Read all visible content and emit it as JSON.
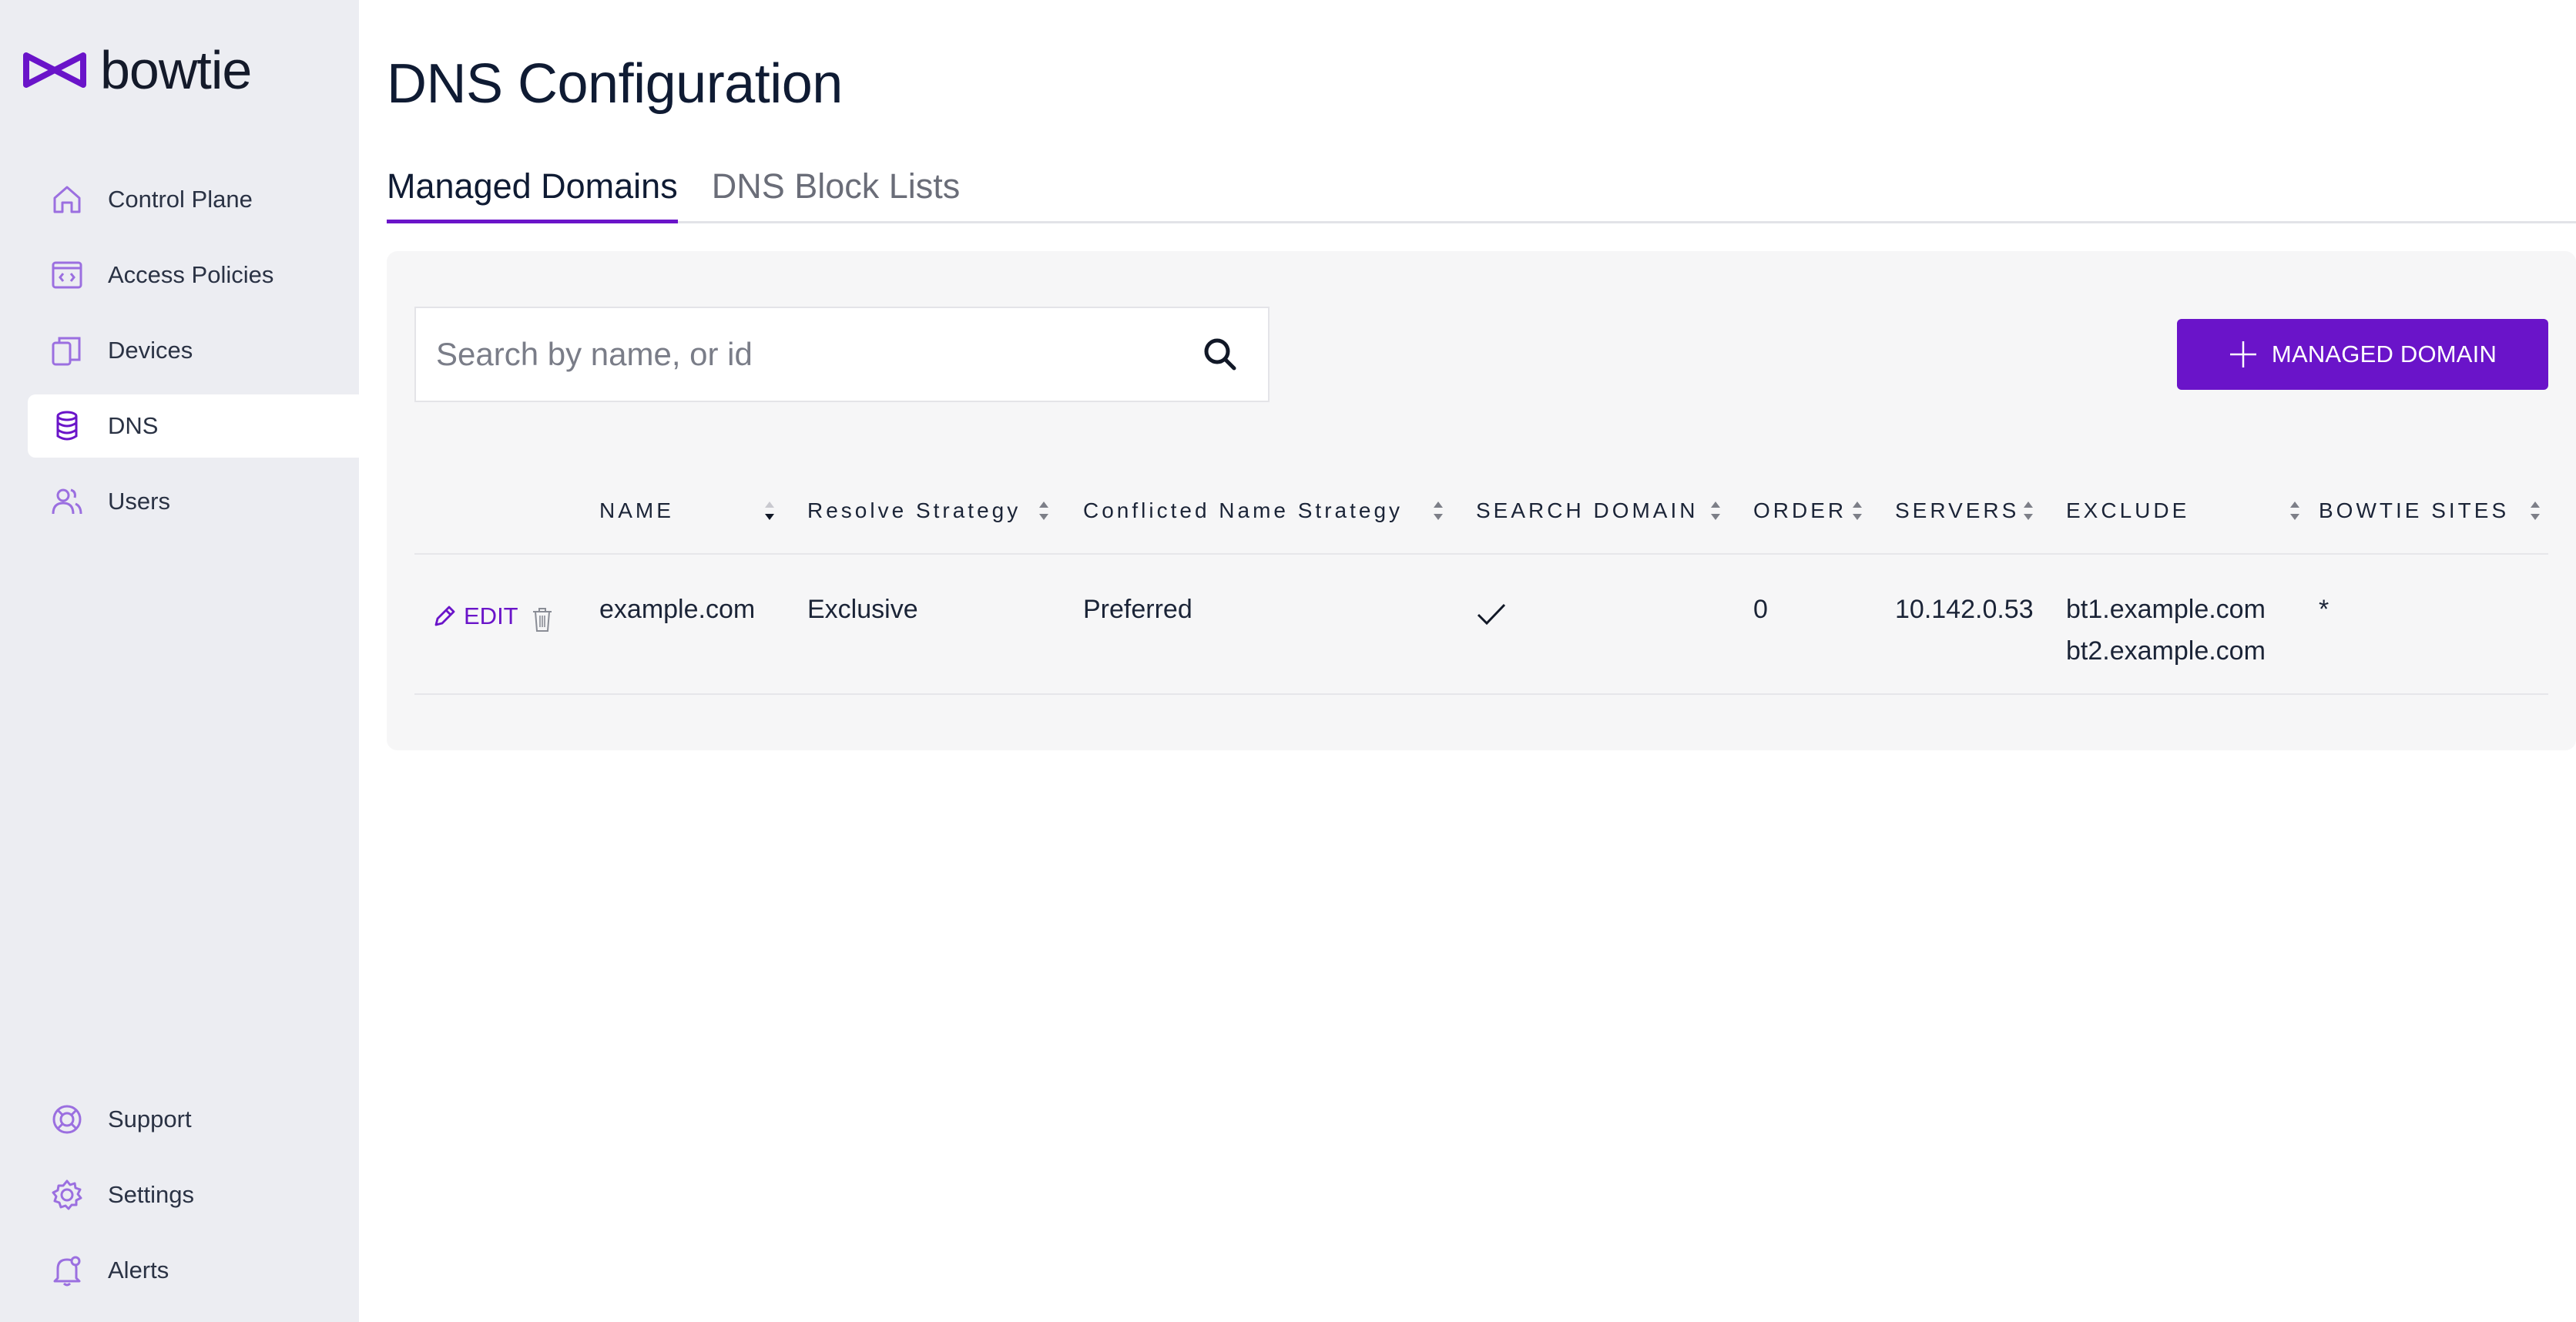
{
  "app": {
    "logo_text": "bowtie",
    "brand_color": "#6a14c9"
  },
  "sidebar": {
    "items": [
      {
        "label": "Control Plane",
        "icon": "home-icon"
      },
      {
        "label": "Access Policies",
        "icon": "code-window-icon"
      },
      {
        "label": "Devices",
        "icon": "devices-icon"
      },
      {
        "label": "DNS",
        "icon": "database-icon",
        "active": true
      },
      {
        "label": "Users",
        "icon": "users-icon"
      }
    ],
    "bottom_items": [
      {
        "label": "Support",
        "icon": "lifebuoy-icon"
      },
      {
        "label": "Settings",
        "icon": "gear-icon"
      },
      {
        "label": "Alerts",
        "icon": "bell-icon"
      }
    ]
  },
  "main": {
    "title": "DNS Configuration",
    "tabs": [
      {
        "label": "Managed Domains",
        "active": true
      },
      {
        "label": "DNS Block Lists",
        "active": false
      }
    ],
    "search": {
      "placeholder": "Search by name, or id",
      "value": ""
    },
    "add_button": {
      "label": "MANAGED DOMAIN"
    },
    "table": {
      "columns": [
        "NAME",
        "Resolve Strategy",
        "Conflicted Name Strategy",
        "SEARCH DOMAIN",
        "ORDER",
        "SERVERS",
        "EXCLUDE",
        "BOWTIE SITES"
      ],
      "edit_label": "EDIT",
      "rows": [
        {
          "name": "example.com",
          "resolve_strategy": "Exclusive",
          "conflicted_name_strategy": "Preferred",
          "search_domain": true,
          "order": "0",
          "servers": "10.142.0.53",
          "exclude": [
            "bt1.example.com",
            "bt2.example.com"
          ],
          "bowtie_sites": "*"
        }
      ]
    }
  }
}
